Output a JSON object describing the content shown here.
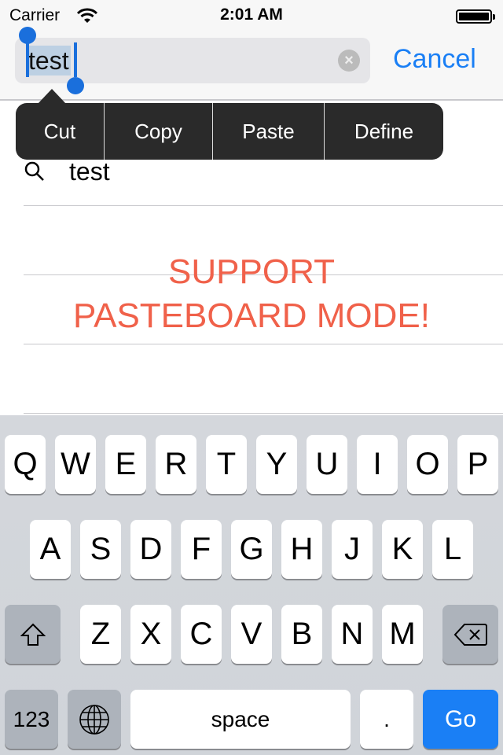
{
  "status": {
    "carrier": "Carrier",
    "time": "2:01 AM",
    "wifi_icon": "wifi-icon",
    "battery_level": 100
  },
  "search": {
    "value": "test",
    "cancel_label": "Cancel"
  },
  "edit_menu": [
    "Cut",
    "Copy",
    "Paste",
    "Define"
  ],
  "results": [
    {
      "text": "test"
    }
  ],
  "banner": {
    "line1": "SUPPORT",
    "line2": "PASTEBOARD MODE!"
  },
  "colors": {
    "accent": "#1a7ff5",
    "banner": "#f0614a",
    "selection": "#bdd0e3"
  },
  "keyboard": {
    "row1": [
      "Q",
      "W",
      "E",
      "R",
      "T",
      "Y",
      "U",
      "I",
      "O",
      "P"
    ],
    "row2": [
      "A",
      "S",
      "D",
      "F",
      "G",
      "H",
      "J",
      "K",
      "L"
    ],
    "row3": [
      "Z",
      "X",
      "C",
      "V",
      "B",
      "N",
      "M"
    ],
    "numbers_label": "123",
    "space_label": "space",
    "period_label": ".",
    "go_label": "Go"
  }
}
